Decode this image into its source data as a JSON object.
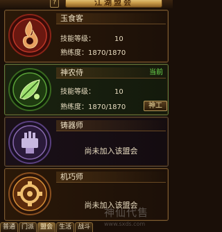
{
  "header": {
    "help": "?",
    "title": "江湖盟会"
  },
  "labels": {
    "skill_level": "技能等级：",
    "proficiency": "熟练度：",
    "not_joined": "尚未加入该盟会",
    "current": "当前"
  },
  "guilds": [
    {
      "name": "玉食客",
      "level": "10",
      "proficiency": "1870/1870",
      "emblem_icon": "chef-fire-icon",
      "color": "#c03828"
    },
    {
      "name": "神农侍",
      "level": "10",
      "proficiency": "1870/1870",
      "emblem_icon": "herb-leaf-icon",
      "color": "#3a8a28",
      "current": true,
      "action": "神工"
    },
    {
      "name": "铸器师",
      "emblem_icon": "forge-gear-icon",
      "color": "#7050a0"
    },
    {
      "name": "机巧师",
      "emblem_icon": "mechanism-cog-icon",
      "color": "#d89038"
    }
  ],
  "tabs": [
    "普通",
    "门派",
    "盟会",
    "生活",
    "战斗"
  ],
  "selected_tab": "盟会",
  "watermark": {
    "text": "神仙代售",
    "url": "www.sxds.com"
  }
}
